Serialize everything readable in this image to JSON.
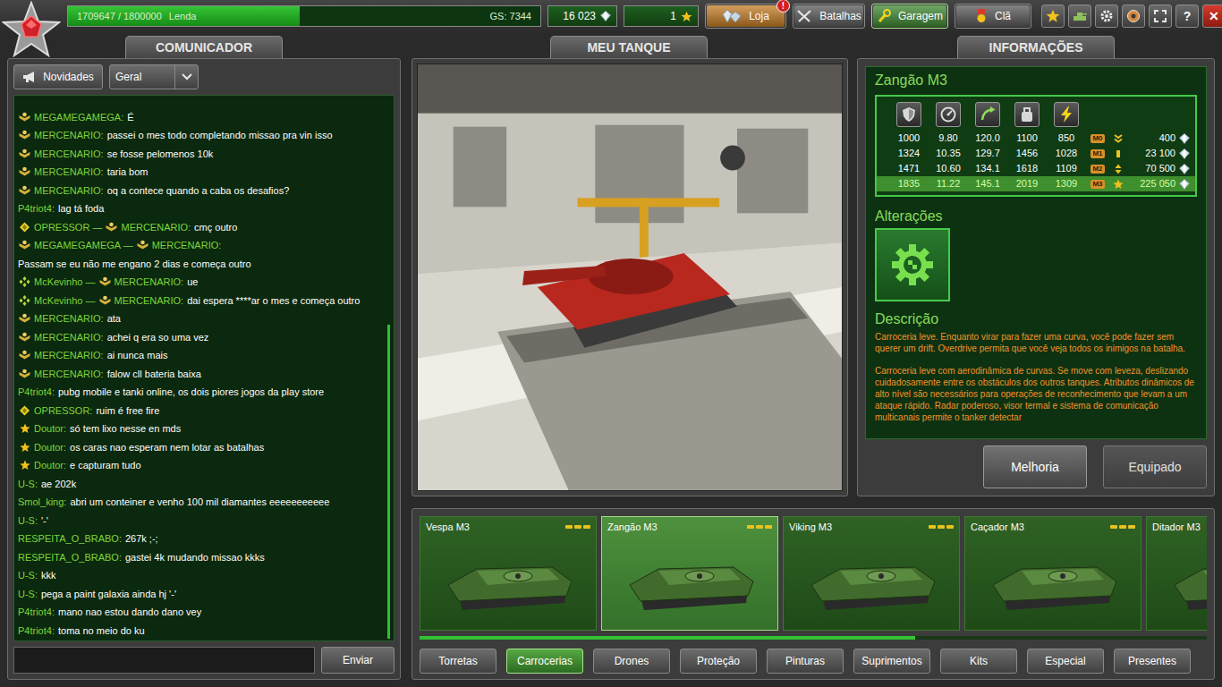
{
  "top_bar": {
    "experience": {
      "text": "1709647 / 1800000",
      "name": "Lenda",
      "level": 0.49
    },
    "gear_score": "GS: 7344",
    "crystals": "16 023",
    "stars": "1",
    "nav": [
      {
        "label": "Loja",
        "badge": "!",
        "selected": false,
        "color": "#c67e26"
      },
      {
        "label": "Batalhas",
        "selected": false,
        "color": "#5a5a5a"
      },
      {
        "label": "Garagem",
        "selected": true,
        "color": "#3f8a32"
      },
      {
        "label": "Clã",
        "selected": false,
        "color": "#5a5a5a"
      }
    ],
    "help": "?",
    "close": "✕"
  },
  "panels": {
    "chat": "COMUNICADOR",
    "tank": "MEU TANQUE",
    "info": "INFORMAÇÕES"
  },
  "chat": {
    "news_button": "Novidades",
    "channel": "Geral",
    "send_button": "Enviar",
    "scroll_level": 1,
    "messages": [
      {
        "kind": "insignia",
        "from": "MEGAMEGAMEGA:",
        "text": "É",
        "newline": false
      },
      {
        "kind": "insignia",
        "from": "MERCENARIO:",
        "text": "passei o mes todo completando missao pra vin isso",
        "newline": false
      },
      {
        "kind": "insignia",
        "from": "MERCENARIO:",
        "text": "se fosse pelomenos 10k",
        "newline": false
      },
      {
        "kind": "insignia",
        "from": "MERCENARIO:",
        "text": "taria bom",
        "newline": false
      },
      {
        "kind": "insignia",
        "from": "MERCENARIO:",
        "text": "oq a contece quando a caba os desafios?",
        "newline": false
      },
      {
        "kind": "none",
        "from": "P4triot4:",
        "text": "lag tá foda",
        "newline": false
      },
      {
        "kind": "diamond",
        "from": "OPRESSOR —",
        "to_kind": "insignia",
        "to": "MERCENARIO:",
        "text": "cmç outro",
        "newline": false
      },
      {
        "kind": "insignia",
        "from": "MEGAMEGAMEGA —",
        "to_kind": "insignia",
        "to": "MERCENARIO:",
        "text": "Passam se eu não me engano 2 dias e começa outro",
        "newline": true
      },
      {
        "kind": "cross",
        "from": "McKevinho —",
        "to_kind": "insignia",
        "to": "MERCENARIO:",
        "text": "ue",
        "newline": false
      },
      {
        "kind": "cross",
        "from": "McKevinho —",
        "to_kind": "insignia",
        "to": "MERCENARIO:",
        "text": "dai espera ****ar o mes e começa outro",
        "newline": false
      },
      {
        "kind": "insignia",
        "from": "MERCENARIO:",
        "text": "ata",
        "newline": false
      },
      {
        "kind": "insignia",
        "from": "MERCENARIO:",
        "text": "achei q era so uma vez",
        "newline": false
      },
      {
        "kind": "insignia",
        "from": "MERCENARIO:",
        "text": "ai nunca mais",
        "newline": false
      },
      {
        "kind": "insignia",
        "from": "MERCENARIO:",
        "text": "falow cll bateria baixa",
        "newline": false
      },
      {
        "kind": "none",
        "from": "P4triot4:",
        "text": "pubg mobile e tanki online, os dois piores jogos da play store",
        "newline": false
      },
      {
        "kind": "diamond",
        "from": "OPRESSOR:",
        "text": "ruim é free fire",
        "newline": false
      },
      {
        "kind": "star",
        "from": "Doutor:",
        "text": "só tem lixo nesse en mds",
        "newline": false
      },
      {
        "kind": "star",
        "from": "Doutor:",
        "text": "os caras nao esperam nem lotar as batalhas",
        "newline": false
      },
      {
        "kind": "star",
        "from": "Doutor:",
        "text": "e capturam tudo",
        "newline": false
      },
      {
        "kind": "none",
        "from": "U-S:",
        "text": "ae 202k",
        "newline": false
      },
      {
        "kind": "none",
        "from": "Smol_king:",
        "text": "abri um conteiner e venho 100 mil diamantes eeeeeeeeeee",
        "newline": false
      },
      {
        "kind": "none",
        "from": "U-S:",
        "text": "'-'",
        "newline": false
      },
      {
        "kind": "none",
        "from": "RESPEITA_O_BRABO:",
        "text": "267k ;-;",
        "newline": false
      },
      {
        "kind": "none",
        "from": "RESPEITA_O_BRABO:",
        "text": "gastei 4k mudando missao kkks",
        "newline": false
      },
      {
        "kind": "none",
        "from": "U-S:",
        "text": "kkk",
        "newline": false
      },
      {
        "kind": "none",
        "from": "U-S:",
        "text": "pega a paint galaxia ainda hj '-'",
        "newline": false
      },
      {
        "kind": "none",
        "from": "P4triot4:",
        "text": "mano nao estou dando dano vey",
        "newline": false
      },
      {
        "kind": "none",
        "from": "P4triot4:",
        "text": "toma no meio do ku",
        "newline": false
      }
    ]
  },
  "info": {
    "title": "Zangão M3",
    "stats": [
      {
        "values": [
          "1000",
          "9.80",
          "120.0",
          "1100",
          "850"
        ],
        "badge": "M0",
        "rank_kind": "chevron",
        "price": "400",
        "selected": false
      },
      {
        "values": [
          "1324",
          "10.35",
          "129.7",
          "1456",
          "1028"
        ],
        "badge": "M1",
        "rank_kind": "bar",
        "price": "23 100",
        "selected": false
      },
      {
        "values": [
          "1471",
          "10.60",
          "134.1",
          "1618",
          "1109"
        ],
        "badge": "M2",
        "rank_kind": "arrows",
        "price": "70 500",
        "selected": false
      },
      {
        "values": [
          "1835",
          "11.22",
          "145.1",
          "2019",
          "1309"
        ],
        "badge": "M3",
        "rank_kind": "star",
        "price": "225 050",
        "selected": true
      }
    ],
    "alterations_label": "Alterações",
    "description_label": "Descrição",
    "description": [
      "Carroceria leve. Enquanto virar para fazer uma curva, você pode fazer sem querer um drift. Overdrive permita que você veja todos os inimigos na batalha.",
      "Carroceria leve com aerodinâmica de curvas. Se move com leveza, deslizando cuidadosamente entre os obstáculos dos outros tanques. Atributos dinâmicos de alto nível são necessários para operações de reconhecimento que levam a um ataque rápido. Radar poderoso, visor termal e sistema de comunicação multicanais permite o tanker detectar"
    ],
    "buttons": [
      {
        "label": "Melhoria",
        "disabled": false
      },
      {
        "label": "Equipado",
        "disabled": true
      }
    ]
  },
  "garage": {
    "items": [
      {
        "name": "Vespa M3",
        "upgrades": 3,
        "selected": false
      },
      {
        "name": "Zangão M3",
        "upgrades": 3,
        "selected": true
      },
      {
        "name": "Viking M3",
        "upgrades": 3,
        "selected": false
      },
      {
        "name": "Caçador M3",
        "upgrades": 3,
        "selected": false
      },
      {
        "name": "Ditador M3",
        "upgrades": 3,
        "selected": false
      }
    ],
    "scroll_level": 0.63,
    "categories": [
      {
        "label": "Torretas",
        "selected": false
      },
      {
        "label": "Carrocerias",
        "selected": true
      },
      {
        "label": "Drones",
        "selected": false
      },
      {
        "label": "Proteção",
        "selected": false
      },
      {
        "label": "Pinturas",
        "selected": false
      },
      {
        "label": "Suprimentos",
        "selected": false
      },
      {
        "label": "Kits",
        "selected": false
      },
      {
        "label": "Especial",
        "selected": false
      },
      {
        "label": "Presentes",
        "selected": false
      }
    ]
  }
}
